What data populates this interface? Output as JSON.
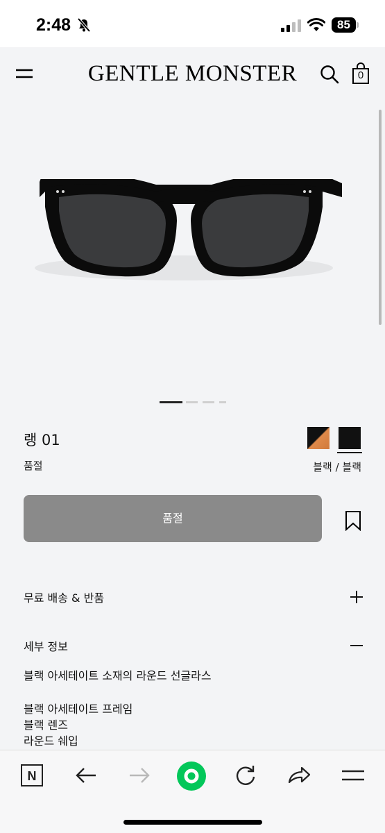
{
  "status_bar": {
    "time": "2:48",
    "battery": "85",
    "icons": [
      "mute-bell-icon",
      "signal-icon",
      "wifi-icon",
      "battery-icon"
    ]
  },
  "header": {
    "brand": "GENTLE MONSTER",
    "cart_count": "0",
    "icons": [
      "menu-icon",
      "search-icon",
      "shopping-bag-icon"
    ]
  },
  "gallery": {
    "image": "black-round-sunglasses",
    "page_count": 4,
    "current_page": 1
  },
  "product": {
    "name": "랭 01",
    "status": "품절",
    "color_label": "블랙 / 블랙",
    "swatches": [
      {
        "name": "black-orange",
        "colors": [
          "#111111",
          "#d8823f"
        ]
      },
      {
        "name": "black",
        "colors": [
          "#111111"
        ],
        "selected": true
      }
    ]
  },
  "actions": {
    "soldout_label": "품절",
    "bookmark_icon": "bookmark-icon"
  },
  "sections": {
    "shipping": {
      "title": "무료 배송 & 반품",
      "toggle": "+"
    },
    "details": {
      "title": "세부 정보",
      "toggle": "−",
      "summary": "블랙 아세테이트 소재의 라운드 선글라스",
      "lines": [
        "블랙 아세테이트 프레임",
        "블랙 렌즈",
        "라운드 쉐입"
      ]
    }
  },
  "toolbar": {
    "icons": [
      "naver-n-icon",
      "back-arrow-icon",
      "forward-arrow-icon",
      "green-home-icon",
      "refresh-icon",
      "share-icon",
      "menu-icon"
    ],
    "accent": "#03c75a"
  }
}
